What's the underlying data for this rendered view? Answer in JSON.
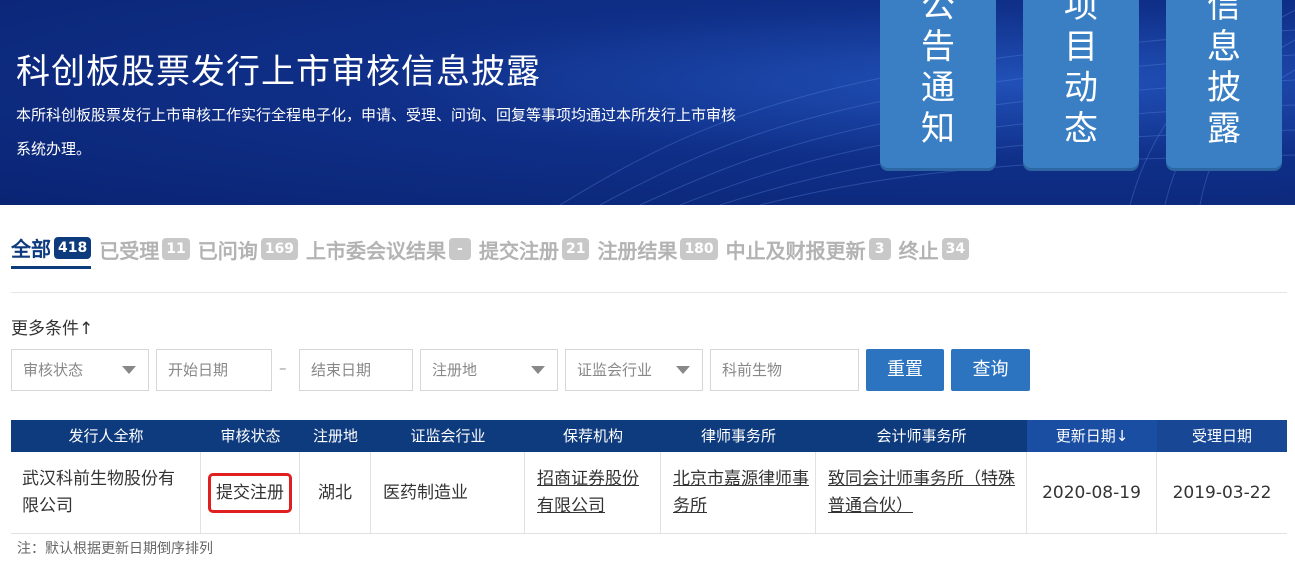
{
  "banner": {
    "title": "科创板股票发行上市审核信息披露",
    "description": "本所科创板股票发行上市审核工作实行全程电子化，申请、受理、问询、回复等事项均通过本所发行上市审核系统办理。",
    "cards": [
      {
        "chars": [
          "公",
          "告",
          "通",
          "知"
        ]
      },
      {
        "chars": [
          "项",
          "目",
          "动",
          "态"
        ]
      },
      {
        "chars": [
          "信",
          "息",
          "披",
          "露"
        ]
      }
    ]
  },
  "tabs": [
    {
      "label": "全部",
      "count": "418",
      "active": true
    },
    {
      "label": "已受理",
      "count": "11"
    },
    {
      "label": "已问询",
      "count": "169"
    },
    {
      "label": "上市委会议结果",
      "count": "-"
    },
    {
      "label": "提交注册",
      "count": "21"
    },
    {
      "label": "注册结果",
      "count": "180"
    },
    {
      "label": "中止及财报更新",
      "count": "3"
    },
    {
      "label": "终止",
      "count": "34"
    }
  ],
  "filters": {
    "more_conditions": "更多条件↑",
    "status_placeholder": "审核状态",
    "start_date_placeholder": "开始日期",
    "date_separator": "–",
    "end_date_placeholder": "结束日期",
    "region_placeholder": "注册地",
    "industry_placeholder": "证监会行业",
    "keyword_value": "科前生物",
    "reset_label": "重置",
    "search_label": "查询"
  },
  "table": {
    "headers": [
      "发行人全称",
      "审核状态",
      "注册地",
      "证监会行业",
      "保荐机构",
      "律师事务所",
      "会计师事务所",
      "更新日期↓",
      "受理日期"
    ],
    "rows": [
      {
        "issuer": "武汉科前生物股份有限公司",
        "status": "提交注册",
        "region": "湖北",
        "industry": "医药制造业",
        "sponsor": "招商证券股份有限公司",
        "law_firm": "北京市嘉源律师事务所",
        "accounting_firm": "致同会计师事务所（特殊普通合伙）",
        "update_date": "2020-08-19",
        "accept_date": "2019-03-22"
      }
    ],
    "note": "注：默认根据更新日期倒序排列"
  },
  "colors": {
    "banner_bg": "#0f2f88",
    "card_bg": "#3a7fc4",
    "tab_active": "#0e3b7e",
    "tab_inactive": "#b3b3b3",
    "header_bg": "#0e3b7e",
    "button_bg": "#2d74c0",
    "highlight_border": "#e02020"
  }
}
